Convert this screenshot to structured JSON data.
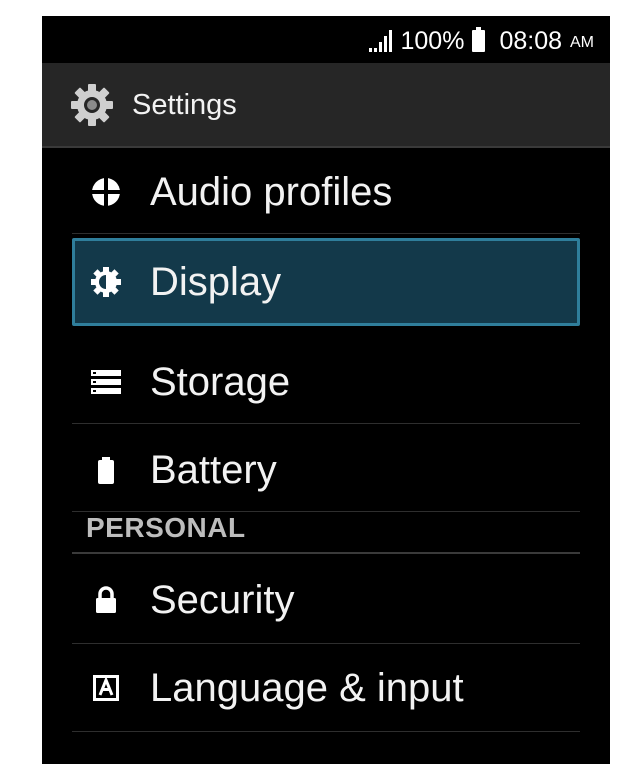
{
  "status_bar": {
    "battery_percent": "100%",
    "time": "08:08",
    "ampm": "AM"
  },
  "action_bar": {
    "title": "Settings",
    "icon": "gear-icon"
  },
  "device_items": [
    {
      "label": "Audio profiles",
      "icon": "audio-profiles-icon"
    },
    {
      "label": "Display",
      "icon": "display-icon",
      "selected": true
    },
    {
      "label": "Storage",
      "icon": "storage-icon"
    },
    {
      "label": "Battery",
      "icon": "battery-icon"
    }
  ],
  "personal_section": {
    "header": "PERSONAL",
    "items": [
      {
        "label": "Security",
        "icon": "lock-icon"
      },
      {
        "label": "Language & input",
        "icon": "language-icon"
      }
    ]
  },
  "colors": {
    "background": "#000000",
    "action_bar": "#262626",
    "selected_fill": "#13394a",
    "selected_border": "#2f7e9b",
    "text": "#f2f2f2"
  }
}
